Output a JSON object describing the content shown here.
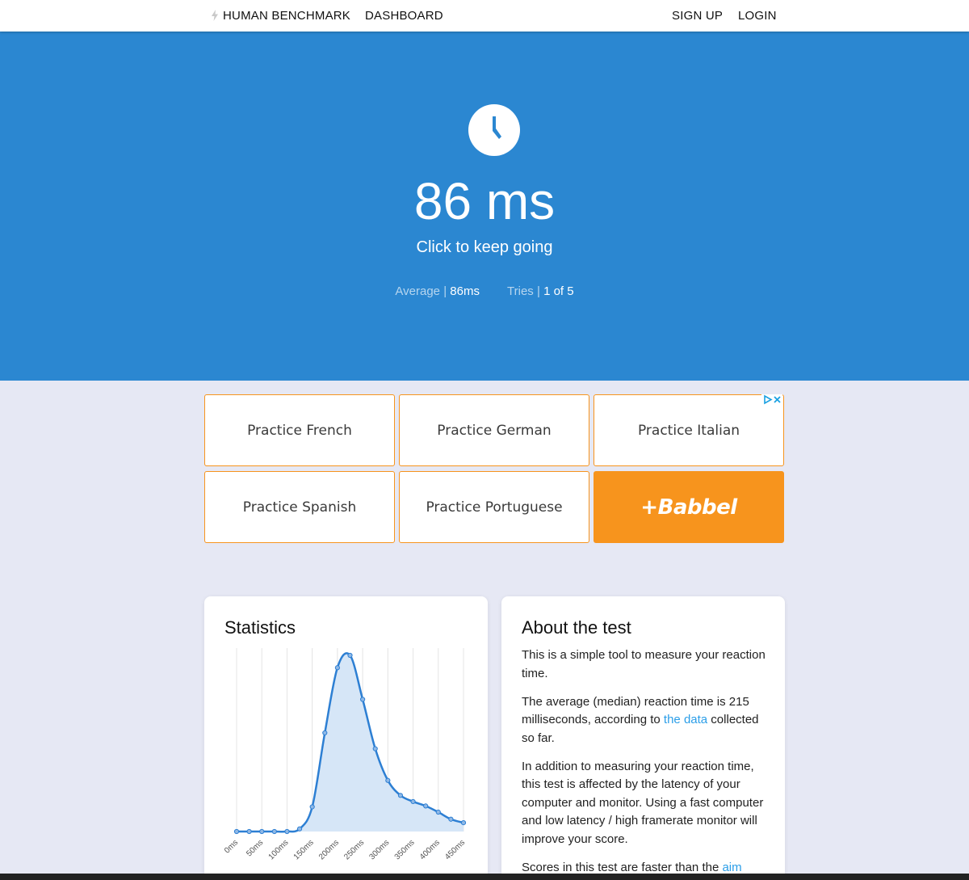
{
  "nav": {
    "brand": "HUMAN BENCHMARK",
    "dashboard": "DASHBOARD",
    "signup": "SIGN UP",
    "login": "LOGIN"
  },
  "hero": {
    "result": "86 ms",
    "prompt": "Click to keep going",
    "average_label": "Average",
    "separator": "|",
    "average_value": "86ms",
    "tries_label": "Tries",
    "tries_value": "1 of 5",
    "background_color": "#2b87d1"
  },
  "ad": {
    "tiles": [
      "Practice French",
      "Practice German",
      "Practice Italian",
      "Practice Spanish",
      "Practice Portuguese"
    ],
    "logo": "+Babbel",
    "accent_color": "#f7941d"
  },
  "statistics": {
    "title": "Statistics"
  },
  "about": {
    "title": "About the test",
    "p1": "This is a simple tool to measure your reaction time.",
    "p2_a": "The average (median) reaction time is 215 milliseconds, according to ",
    "p2_link": "the data",
    "p2_b": " collected so far.",
    "p3": "In addition to measuring your reaction time, this test is affected by the latency of your computer and monitor. Using a fast computer and low latency / high framerate monitor will improve your score.",
    "p4_a": "Scores in this test are faster than the ",
    "p4_link": "aim"
  },
  "chart_data": {
    "type": "area",
    "title": "",
    "xlabel": "",
    "ylabel": "",
    "x": [
      0,
      25,
      50,
      75,
      100,
      125,
      150,
      175,
      200,
      225,
      250,
      275,
      300,
      325,
      350,
      375,
      400,
      425,
      450
    ],
    "tick_labels": [
      "0ms",
      "50ms",
      "100ms",
      "150ms",
      "200ms",
      "250ms",
      "300ms",
      "350ms",
      "400ms",
      "450ms"
    ],
    "tick_values": [
      0,
      50,
      100,
      150,
      200,
      250,
      300,
      350,
      400,
      450
    ],
    "values": [
      0.0,
      0.0,
      0.0,
      0.0,
      0.0,
      0.015,
      0.14,
      0.56,
      0.93,
      1.0,
      0.75,
      0.47,
      0.29,
      0.205,
      0.17,
      0.145,
      0.11,
      0.07,
      0.05
    ],
    "xlim": [
      0,
      450
    ],
    "ylim": [
      0,
      1
    ],
    "grid": true,
    "line_color": "#2d7fd3",
    "fill_color": "#d6e6f7"
  }
}
